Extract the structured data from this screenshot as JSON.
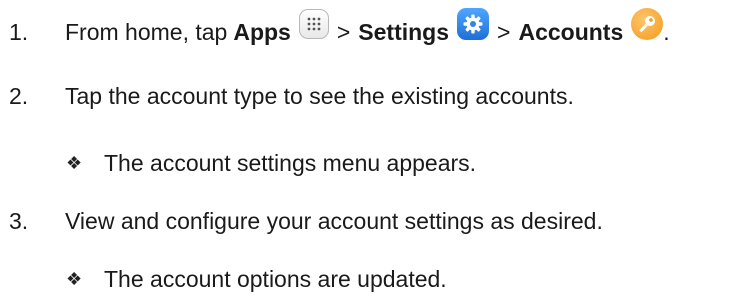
{
  "steps": [
    {
      "number": "1.",
      "text_prefix": "From home, tap",
      "apps_label": "Apps",
      "settings_label": "Settings",
      "accounts_label": "Accounts",
      "separator": ">",
      "end": "."
    },
    {
      "number": "2.",
      "text": "Tap the account type to see the existing accounts."
    },
    {
      "number": "3.",
      "text": "View and configure your account settings as desired."
    }
  ],
  "results": [
    {
      "bullet": "❖",
      "text": "The account settings menu appears."
    },
    {
      "bullet": "❖",
      "text": "The account options are updated."
    }
  ],
  "icons": {
    "apps": "apps-grid-icon",
    "settings": "settings-gear-icon",
    "accounts": "accounts-key-icon"
  },
  "colors": {
    "settings_blue": "#2f86ea",
    "accounts_orange": "#f5a623"
  }
}
